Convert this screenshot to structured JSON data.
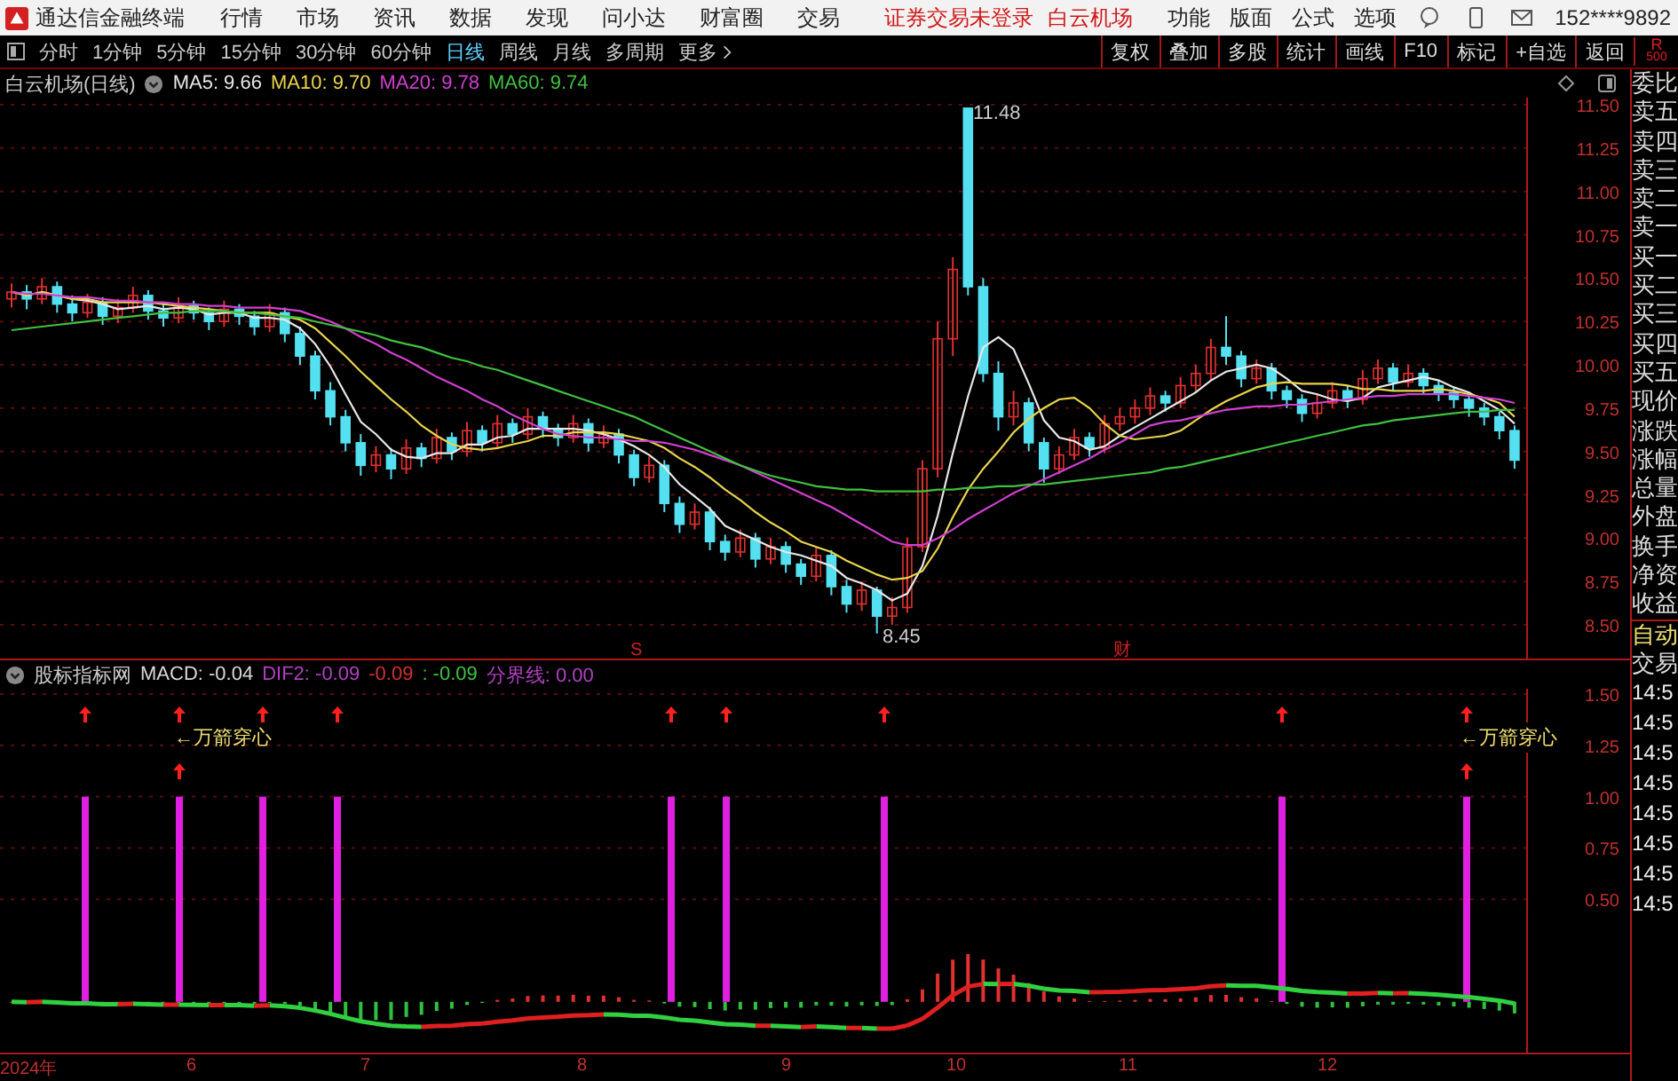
{
  "title_bar": {
    "app_name": "通达信金融终端",
    "menu": [
      "行情",
      "市场",
      "资讯",
      "数据",
      "发现",
      "问小达",
      "财富圈",
      "交易"
    ],
    "notice": "证券交易未登录",
    "stock": "白云机场",
    "tools": [
      "功能",
      "版面",
      "公式",
      "选项"
    ],
    "account": "152****9892"
  },
  "period_tabs": [
    {
      "label": "分时",
      "selected": false
    },
    {
      "label": "1分钟",
      "selected": false
    },
    {
      "label": "5分钟",
      "selected": false
    },
    {
      "label": "15分钟",
      "selected": false
    },
    {
      "label": "30分钟",
      "selected": false
    },
    {
      "label": "60分钟",
      "selected": false
    },
    {
      "label": "日线",
      "selected": true
    },
    {
      "label": "周线",
      "selected": false
    },
    {
      "label": "月线",
      "selected": false
    },
    {
      "label": "多周期",
      "selected": false
    },
    {
      "label": "更多",
      "selected": false
    }
  ],
  "toolbar_buttons": [
    "复权",
    "叠加",
    "多股",
    "统计",
    "画线",
    "F10",
    "标记",
    "+自选",
    "返回"
  ],
  "corner_badge": {
    "letter": "R",
    "number": "500"
  },
  "price_chart": {
    "title": "白云机场(日线)",
    "chart_data": {
      "type": "candlestick",
      "grid": true,
      "ylim": [
        8.5,
        11.5
      ],
      "ohlc": [
        [
          10.38,
          10.47,
          10.33,
          10.42
        ],
        [
          10.42,
          10.46,
          10.32,
          10.38
        ],
        [
          10.38,
          10.5,
          10.35,
          10.45
        ],
        [
          10.45,
          10.48,
          10.3,
          10.35
        ],
        [
          10.35,
          10.4,
          10.25,
          10.3
        ],
        [
          10.3,
          10.41,
          10.27,
          10.36
        ],
        [
          10.36,
          10.39,
          10.23,
          10.28
        ],
        [
          10.28,
          10.38,
          10.24,
          10.33
        ],
        [
          10.33,
          10.45,
          10.3,
          10.4
        ],
        [
          10.4,
          10.43,
          10.26,
          10.31
        ],
        [
          10.31,
          10.35,
          10.22,
          10.27
        ],
        [
          10.27,
          10.39,
          10.24,
          10.34
        ],
        [
          10.34,
          10.37,
          10.26,
          10.3
        ],
        [
          10.3,
          10.33,
          10.2,
          10.25
        ],
        [
          10.25,
          10.37,
          10.22,
          10.32
        ],
        [
          10.32,
          10.35,
          10.23,
          10.28
        ],
        [
          10.28,
          10.31,
          10.17,
          10.22
        ],
        [
          10.22,
          10.35,
          10.19,
          10.3
        ],
        [
          10.3,
          10.33,
          10.13,
          10.18
        ],
        [
          10.18,
          10.22,
          10.0,
          10.05
        ],
        [
          10.05,
          10.08,
          9.8,
          9.85
        ],
        [
          9.85,
          9.9,
          9.65,
          9.7
        ],
        [
          9.7,
          9.74,
          9.5,
          9.55
        ],
        [
          9.55,
          9.6,
          9.36,
          9.42
        ],
        [
          9.42,
          9.53,
          9.38,
          9.48
        ],
        [
          9.48,
          9.52,
          9.34,
          9.4
        ],
        [
          9.4,
          9.57,
          9.37,
          9.52
        ],
        [
          9.52,
          9.55,
          9.41,
          9.46
        ],
        [
          9.46,
          9.63,
          9.43,
          9.58
        ],
        [
          9.58,
          9.61,
          9.45,
          9.5
        ],
        [
          9.5,
          9.67,
          9.47,
          9.62
        ],
        [
          9.62,
          9.65,
          9.5,
          9.55
        ],
        [
          9.55,
          9.71,
          9.52,
          9.66
        ],
        [
          9.66,
          9.69,
          9.55,
          9.6
        ],
        [
          9.6,
          9.75,
          9.57,
          9.7
        ],
        [
          9.7,
          9.73,
          9.58,
          9.63
        ],
        [
          9.63,
          9.66,
          9.53,
          9.58
        ],
        [
          9.58,
          9.71,
          9.55,
          9.66
        ],
        [
          9.66,
          9.69,
          9.5,
          9.55
        ],
        [
          9.55,
          9.65,
          9.52,
          9.6
        ],
        [
          9.6,
          9.63,
          9.43,
          9.48
        ],
        [
          9.48,
          9.51,
          9.3,
          9.35
        ],
        [
          9.35,
          9.47,
          9.32,
          9.42
        ],
        [
          9.42,
          9.45,
          9.15,
          9.2
        ],
        [
          9.2,
          9.24,
          9.03,
          9.08
        ],
        [
          9.08,
          9.2,
          9.05,
          9.15
        ],
        [
          9.15,
          9.18,
          8.93,
          8.98
        ],
        [
          8.98,
          9.02,
          8.87,
          8.92
        ],
        [
          8.92,
          9.05,
          8.89,
          9.0
        ],
        [
          9.0,
          9.03,
          8.83,
          8.88
        ],
        [
          8.88,
          9.0,
          8.85,
          8.95
        ],
        [
          8.95,
          8.98,
          8.8,
          8.85
        ],
        [
          8.85,
          8.88,
          8.73,
          8.78
        ],
        [
          8.78,
          8.95,
          8.75,
          8.9
        ],
        [
          8.9,
          8.93,
          8.67,
          8.72
        ],
        [
          8.72,
          8.76,
          8.57,
          8.62
        ],
        [
          8.62,
          8.75,
          8.58,
          8.7
        ],
        [
          8.7,
          8.72,
          8.45,
          8.55
        ],
        [
          8.55,
          8.66,
          8.5,
          8.6
        ],
        [
          8.6,
          9.0,
          8.57,
          8.95
        ],
        [
          8.95,
          9.45,
          8.92,
          9.4
        ],
        [
          9.4,
          10.25,
          9.35,
          10.15
        ],
        [
          10.15,
          10.62,
          10.05,
          10.55
        ],
        [
          11.48,
          11.48,
          10.4,
          10.45
        ],
        [
          10.45,
          10.5,
          9.9,
          9.95
        ],
        [
          9.95,
          10.02,
          9.62,
          9.7
        ],
        [
          9.7,
          9.85,
          9.65,
          9.78
        ],
        [
          9.78,
          9.81,
          9.5,
          9.55
        ],
        [
          9.55,
          9.58,
          9.32,
          9.4
        ],
        [
          9.4,
          9.53,
          9.37,
          9.48
        ],
        [
          9.48,
          9.63,
          9.45,
          9.58
        ],
        [
          9.58,
          9.61,
          9.47,
          9.52
        ],
        [
          9.52,
          9.71,
          9.49,
          9.66
        ],
        [
          9.66,
          9.75,
          9.62,
          9.7
        ],
        [
          9.7,
          9.8,
          9.66,
          9.75
        ],
        [
          9.75,
          9.87,
          9.71,
          9.82
        ],
        [
          9.82,
          9.85,
          9.73,
          9.78
        ],
        [
          9.78,
          9.93,
          9.75,
          9.88
        ],
        [
          9.88,
          10.0,
          9.84,
          9.95
        ],
        [
          9.95,
          10.15,
          9.91,
          10.1
        ],
        [
          10.1,
          10.28,
          10.0,
          10.05
        ],
        [
          10.05,
          10.08,
          9.87,
          9.92
        ],
        [
          9.92,
          10.03,
          9.89,
          9.98
        ],
        [
          9.98,
          10.01,
          9.8,
          9.85
        ],
        [
          9.85,
          9.88,
          9.75,
          9.8
        ],
        [
          9.8,
          9.83,
          9.67,
          9.72
        ],
        [
          9.72,
          9.83,
          9.69,
          9.78
        ],
        [
          9.78,
          9.9,
          9.75,
          9.85
        ],
        [
          9.85,
          9.88,
          9.75,
          9.8
        ],
        [
          9.8,
          9.97,
          9.77,
          9.92
        ],
        [
          9.92,
          10.03,
          9.89,
          9.98
        ],
        [
          9.98,
          10.01,
          9.85,
          9.9
        ],
        [
          9.9,
          10.0,
          9.87,
          9.95
        ],
        [
          9.95,
          9.98,
          9.83,
          9.88
        ],
        [
          9.88,
          9.91,
          9.79,
          9.84
        ],
        [
          9.84,
          9.87,
          9.75,
          9.8
        ],
        [
          9.8,
          9.83,
          9.7,
          9.75
        ],
        [
          9.75,
          9.78,
          9.65,
          9.7
        ],
        [
          9.7,
          9.73,
          9.57,
          9.62
        ],
        [
          9.62,
          9.65,
          9.4,
          9.45
        ]
      ],
      "yticks": [
        {
          "value": 11.5,
          "label": "11.50"
        },
        {
          "value": 11.25,
          "label": "11.25"
        },
        {
          "value": 11,
          "label": "11.00"
        },
        {
          "value": 10.75,
          "label": "10.75"
        },
        {
          "value": 10.5,
          "label": "10.50"
        },
        {
          "value": 10.25,
          "label": "10.25"
        },
        {
          "value": 10,
          "label": "10.00"
        },
        {
          "value": 9.75,
          "label": "9.75"
        },
        {
          "value": 9.5,
          "label": "9.50"
        },
        {
          "value": 9.25,
          "label": "9.25"
        },
        {
          "value": 9,
          "label": "9.00"
        },
        {
          "value": 8.75,
          "label": "8.75"
        },
        {
          "value": 8.5,
          "label": "8.50"
        }
      ],
      "series": [
        {
          "name": "MA5: 9.66",
          "type": "line",
          "color": "#e8e8e8",
          "values": [
            null,
            null,
            10.42,
            10.4,
            10.38,
            10.37,
            10.35,
            10.32,
            10.33,
            10.34,
            10.32,
            10.33,
            10.32,
            10.29,
            10.3,
            10.3,
            10.27,
            10.27,
            10.26,
            10.21,
            10.12,
            9.99,
            9.83,
            9.67,
            9.6,
            9.51,
            9.47,
            9.46,
            9.49,
            9.49,
            9.54,
            9.54,
            9.58,
            9.59,
            9.63,
            9.63,
            9.63,
            9.63,
            9.62,
            9.6,
            9.57,
            9.53,
            9.48,
            9.41,
            9.31,
            9.24,
            9.17,
            9.07,
            9.03,
            8.99,
            8.95,
            8.92,
            8.9,
            8.87,
            8.84,
            8.77,
            8.74,
            8.7,
            8.64,
            8.68,
            8.84,
            9.13,
            9.49,
            9.82,
            10.1,
            10.16,
            10.09,
            9.89,
            9.68,
            9.58,
            9.56,
            9.51,
            9.53,
            9.59,
            9.64,
            9.69,
            9.74,
            9.79,
            9.84,
            9.91,
            9.96,
            9.98,
            10.0,
            9.98,
            9.92,
            9.85,
            9.83,
            9.8,
            9.79,
            9.81,
            9.87,
            9.89,
            9.91,
            9.93,
            9.91,
            9.87,
            9.84,
            9.79,
            9.74,
            9.66
          ]
        },
        {
          "name": "MA10: 9.70",
          "type": "line",
          "color": "#e8d44d",
          "values": [
            10.42,
            10.4,
            10.42,
            10.4,
            10.38,
            10.38,
            10.36,
            10.36,
            10.36,
            10.36,
            10.35,
            10.34,
            10.33,
            10.32,
            10.31,
            10.3,
            10.3,
            10.3,
            10.28,
            10.26,
            10.21,
            10.13,
            10.05,
            9.96,
            9.88,
            9.8,
            9.73,
            9.65,
            9.59,
            9.54,
            9.52,
            9.51,
            9.52,
            9.54,
            9.56,
            9.59,
            9.59,
            9.61,
            9.61,
            9.61,
            9.6,
            9.58,
            9.56,
            9.52,
            9.46,
            9.41,
            9.35,
            9.28,
            9.22,
            9.15,
            9.09,
            9.04,
            8.98,
            8.95,
            8.92,
            8.87,
            8.83,
            8.79,
            8.76,
            8.77,
            8.81,
            8.94,
            9.12,
            9.28,
            9.4,
            9.5,
            9.61,
            9.69,
            9.75,
            9.8,
            9.81,
            9.75,
            9.66,
            9.59,
            9.57,
            9.58,
            9.59,
            9.62,
            9.68,
            9.74,
            9.79,
            9.83,
            9.87,
            9.89,
            9.9,
            9.89,
            9.89,
            9.89,
            9.88,
            9.86,
            9.86,
            9.85,
            9.85,
            9.85,
            9.86,
            9.85,
            9.83,
            9.81,
            9.78,
            9.7
          ]
        },
        {
          "name": "MA20: 9.78",
          "type": "line",
          "color": "#d040d0",
          "values": [
            10.42,
            10.41,
            10.41,
            10.4,
            10.39,
            10.39,
            10.38,
            10.37,
            10.37,
            10.36,
            10.36,
            10.35,
            10.35,
            10.34,
            10.34,
            10.33,
            10.33,
            10.33,
            10.32,
            10.31,
            10.28,
            10.25,
            10.21,
            10.16,
            10.12,
            10.07,
            10.03,
            9.98,
            9.93,
            9.89,
            9.85,
            9.8,
            9.76,
            9.71,
            9.67,
            9.63,
            9.6,
            9.59,
            9.58,
            9.58,
            9.57,
            9.56,
            9.56,
            9.55,
            9.53,
            9.51,
            9.48,
            9.45,
            9.42,
            9.38,
            9.34,
            9.3,
            9.26,
            9.22,
            9.18,
            9.13,
            9.08,
            9.03,
            8.98,
            8.96,
            8.96,
            9.0,
            9.05,
            9.11,
            9.16,
            9.21,
            9.26,
            9.3,
            9.34,
            9.38,
            9.42,
            9.46,
            9.51,
            9.55,
            9.6,
            9.65,
            9.67,
            9.68,
            9.7,
            9.72,
            9.74,
            9.75,
            9.76,
            9.76,
            9.77,
            9.77,
            9.78,
            9.79,
            9.8,
            9.81,
            9.82,
            9.82,
            9.83,
            9.83,
            9.83,
            9.83,
            9.82,
            9.81,
            9.8,
            9.78
          ]
        },
        {
          "name": "MA60: 9.74",
          "type": "line",
          "color": "#40c040",
          "values": [
            10.2,
            10.21,
            10.22,
            10.23,
            10.24,
            10.25,
            10.26,
            10.27,
            10.28,
            10.29,
            10.3,
            10.3,
            10.31,
            10.31,
            10.31,
            10.3,
            10.3,
            10.29,
            10.28,
            10.27,
            10.25,
            10.23,
            10.21,
            10.19,
            10.17,
            10.14,
            10.12,
            10.1,
            10.07,
            10.04,
            10.02,
            9.99,
            9.97,
            9.94,
            9.91,
            9.88,
            9.85,
            9.82,
            9.79,
            9.76,
            9.73,
            9.7,
            9.66,
            9.62,
            9.58,
            9.54,
            9.5,
            9.46,
            9.42,
            9.39,
            9.36,
            9.34,
            9.32,
            9.3,
            9.29,
            9.28,
            9.28,
            9.27,
            9.27,
            9.27,
            9.27,
            9.28,
            9.28,
            9.29,
            9.29,
            9.3,
            9.3,
            9.31,
            9.31,
            9.32,
            9.33,
            9.34,
            9.35,
            9.36,
            9.37,
            9.38,
            9.4,
            9.41,
            9.43,
            9.45,
            9.47,
            9.49,
            9.51,
            9.53,
            9.55,
            9.57,
            9.59,
            9.61,
            9.63,
            9.65,
            9.66,
            9.68,
            9.69,
            9.7,
            9.71,
            9.72,
            9.73,
            9.73,
            9.74,
            9.74
          ]
        }
      ]
    },
    "high_label": "11.48",
    "low_label": "8.45",
    "markers": [
      "S",
      "财"
    ]
  },
  "indicator": {
    "name": "股标指标网",
    "values": [
      {
        "label": "MACD: -0.04",
        "color": "#d8d8d8"
      },
      {
        "label": "DIF2: -0.09",
        "color": "#b040c0"
      },
      {
        "label": "-0.09",
        "color": "#d03030"
      },
      {
        "label": ": -0.09",
        "color": "#40c040"
      },
      {
        "label": "分界线: 0.00",
        "color": "#b040c0"
      }
    ],
    "y_ticks": [
      "1.50",
      "1.25",
      "1.00",
      "0.75",
      "0.50"
    ],
    "signal_labels": [
      "←万箭穿心",
      "←万箭穿心"
    ]
  },
  "quote_panel": {
    "labels": [
      "委比",
      "卖五",
      "卖四",
      "卖三",
      "卖二",
      "卖一",
      "买一",
      "买二",
      "买三",
      "买四",
      "买五",
      "现价",
      "涨跌",
      "涨幅",
      "总量",
      "外盘",
      "换手",
      "净资",
      "收益"
    ],
    "mode": "自动",
    "trade": "交易",
    "times": [
      "14:5",
      "14:5",
      "14:5",
      "14:5",
      "14:5",
      "14:5",
      "14:5",
      "14:5"
    ]
  },
  "date_axis": [
    "2024年",
    "6",
    "7",
    "8",
    "9",
    "10",
    "11",
    "12"
  ]
}
